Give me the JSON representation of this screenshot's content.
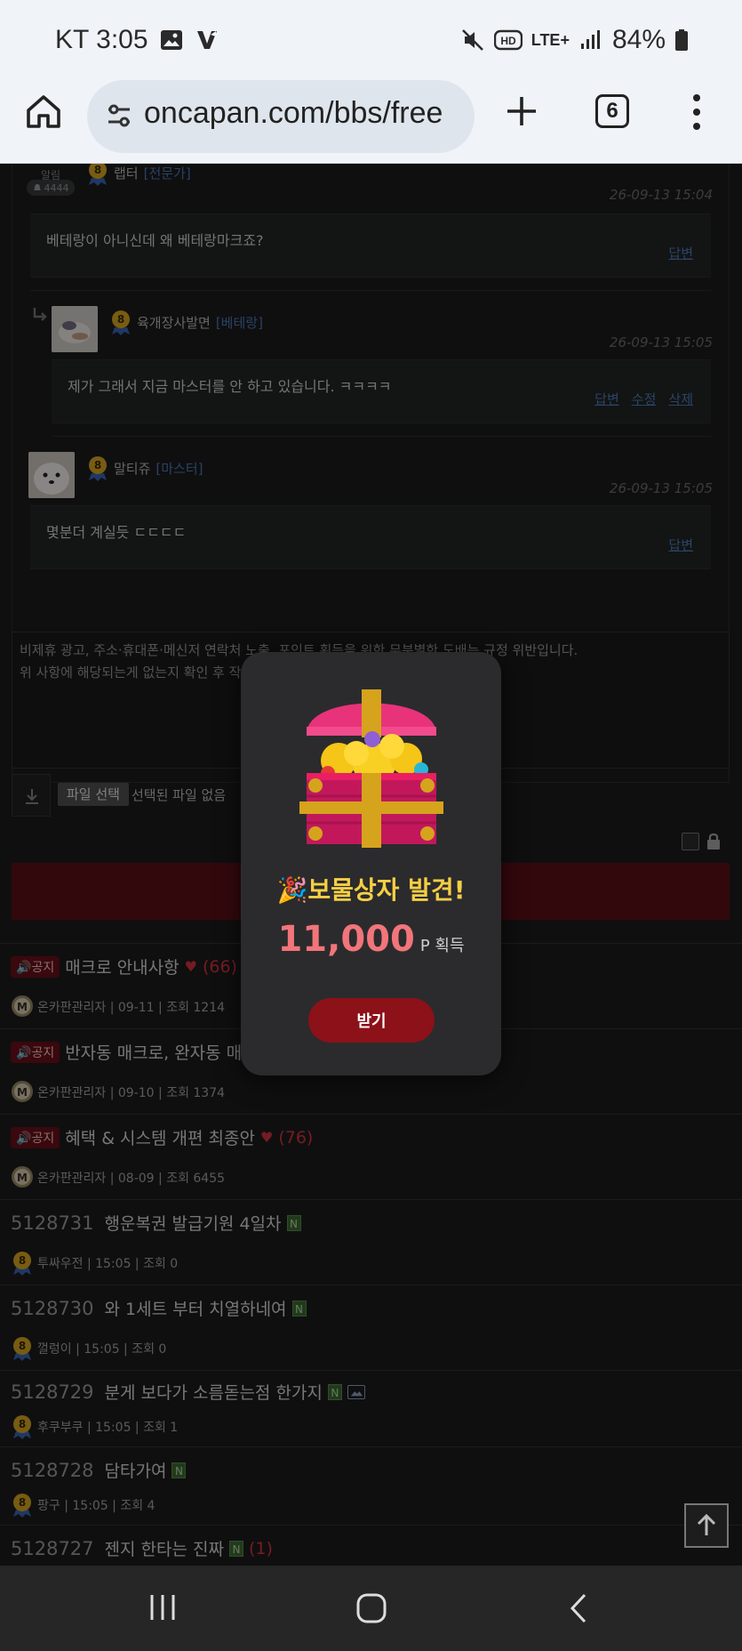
{
  "status_bar": {
    "carrier_time": "KT 3:05",
    "network": "LTE+",
    "battery": "84%"
  },
  "browser": {
    "url": "oncapan.com/bbs/free",
    "tab_count": "6"
  },
  "notification": {
    "label": "알림",
    "count": "4444"
  },
  "comments": [
    {
      "author": "랩터",
      "rank": "[전문가]",
      "level": "8",
      "date": "26-09-13 15:04",
      "text": "베테랑이 아니신데 왜 베테랑마크죠?",
      "links": [
        "답변"
      ]
    },
    {
      "author": "육개장사발면",
      "rank": "[베테랑]",
      "level": "8",
      "date": "26-09-13 15:05",
      "text": "제가 그래서 지금 마스터를 안 하고 있습니다. ㅋㅋㅋㅋ",
      "links": [
        "답변",
        "수정",
        "삭제"
      ]
    },
    {
      "author": "말티쥬",
      "rank": "[마스터]",
      "level": "8",
      "date": "26-09-13 15:05",
      "text": "몇분더 계실듯 ㄷㄷㄷㄷ",
      "links": [
        "답변"
      ]
    }
  ],
  "editor": {
    "placeholder_line1": "비제휴 광고, 주소·휴대폰·메신저 연락처 노출, 포인트 획득을 위한 무분별한 도배는 규정 위반입니다.",
    "placeholder_line2": "위 사항에 해당되는게 없는지 확인 후 작성",
    "file_button": "파일 선택",
    "file_status": "선택된 파일 없음"
  },
  "posts": [
    {
      "notice": "공지",
      "title": "매크로 안내사항",
      "heart": "♥",
      "comments": "(66)",
      "meta": "온카판관리자 | 09-11 | 조회 1214",
      "icon": "M"
    },
    {
      "notice": "공지",
      "title": "반자동 매크로, 완자동 매크",
      "meta": "온카판관리자 | 09-10 | 조회 1374",
      "icon": "M"
    },
    {
      "notice": "공지",
      "title": "혜택 & 시스템 개편 최종안",
      "heart": "♥",
      "comments": "(76)",
      "meta": "온카판관리자 | 08-09 | 조회 6455",
      "icon": "M"
    },
    {
      "num": "5128731",
      "title": "행운복권 발급기원 4일차",
      "new": "N",
      "meta": "투싸우전 | 15:05 | 조회 0",
      "icon": "8"
    },
    {
      "num": "5128730",
      "title": "와 1세트 부터 치열하네여",
      "new": "N",
      "meta": "껄렁이 | 15:05 | 조회 0",
      "icon": "8"
    },
    {
      "num": "5128729",
      "title": "분게 보다가 소름돋는점 한가지",
      "new": "N",
      "image": true,
      "meta": "후쿠부쿠 | 15:05 | 조회 1",
      "icon": "8"
    },
    {
      "num": "5128728",
      "title": "담타가여",
      "new": "N",
      "meta": "팡구 | 15:05 | 조회 4",
      "icon": "8"
    },
    {
      "num": "5128727",
      "title": "젠지 한타는 진짜",
      "new": "N",
      "comments": "(1)",
      "meta": "",
      "icon": "8"
    }
  ],
  "popup": {
    "title": "🎉보물상자 발견!",
    "amount": "11,000",
    "unit": "P 획득",
    "button": "받기"
  },
  "colors": {
    "accent_red": "#8c1119",
    "gold": "#f5cf45",
    "amount_pink": "#f1757a",
    "link_blue": "#4c7eb8"
  }
}
